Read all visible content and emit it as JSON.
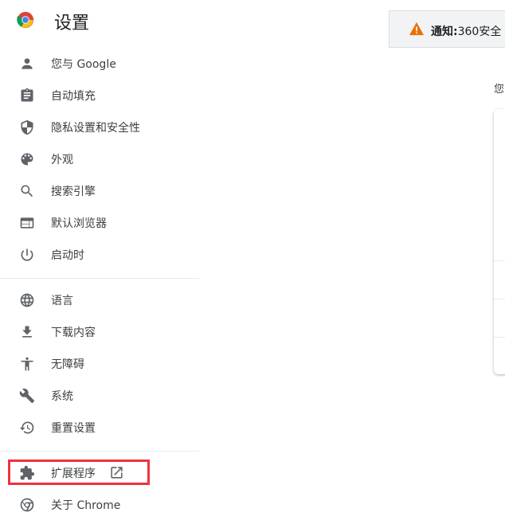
{
  "app": {
    "title": "设置",
    "logo_icon": "chrome-logo-icon"
  },
  "sidebar": {
    "items": [
      {
        "label": "您与 Google",
        "icon": "person-icon"
      },
      {
        "label": "自动填充",
        "icon": "clipboard-icon"
      },
      {
        "label": "隐私设置和安全性",
        "icon": "shield-icon"
      },
      {
        "label": "外观",
        "icon": "palette-icon"
      },
      {
        "label": "搜索引擎",
        "icon": "search-icon"
      },
      {
        "label": "默认浏览器",
        "icon": "browser-window-icon"
      },
      {
        "label": "启动时",
        "icon": "power-icon"
      },
      {
        "label": "语言",
        "icon": "globe-icon"
      },
      {
        "label": "下载内容",
        "icon": "download-icon"
      },
      {
        "label": "无障碍",
        "icon": "accessibility-icon"
      },
      {
        "label": "系统",
        "icon": "wrench-icon"
      },
      {
        "label": "重置设置",
        "icon": "history-icon"
      },
      {
        "label": "扩展程序",
        "icon": "puzzle-icon"
      },
      {
        "label": "关于 Chrome",
        "icon": "chrome-icon"
      }
    ]
  },
  "notice": {
    "label": "通知:",
    "text": "360安全"
  },
  "main": {
    "partial_text": "您"
  },
  "colors": {
    "highlight": "#ef3340",
    "warning": "#e8710a",
    "icon": "#5f6368"
  }
}
